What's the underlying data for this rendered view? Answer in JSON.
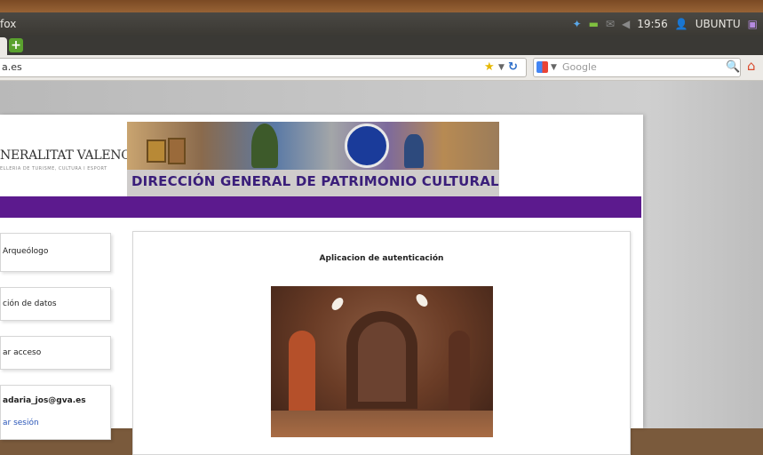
{
  "panel": {
    "title": "fox",
    "clock": "19:56",
    "user": "UBUNTU"
  },
  "browser": {
    "url": "a.es",
    "search_placeholder": "Google"
  },
  "header": {
    "org_name": "NERALITAT VALENCIANA",
    "org_sub": "ELLERIA DE TURISME, CULTURA I ESPORT",
    "banner_title": "DIRECCIÓN GENERAL DE PATRIMONIO CULTURAL",
    "accent_color": "#5c1a8e"
  },
  "sidebar": {
    "items": [
      {
        "label": "Arqueólogo"
      },
      {
        "label": "ción de datos"
      },
      {
        "label": "ar acceso"
      },
      {
        "label": "adaria_jos@gva.es"
      },
      {
        "label": "ar sesión"
      }
    ]
  },
  "main": {
    "title": "Aplicacion de autenticación"
  }
}
